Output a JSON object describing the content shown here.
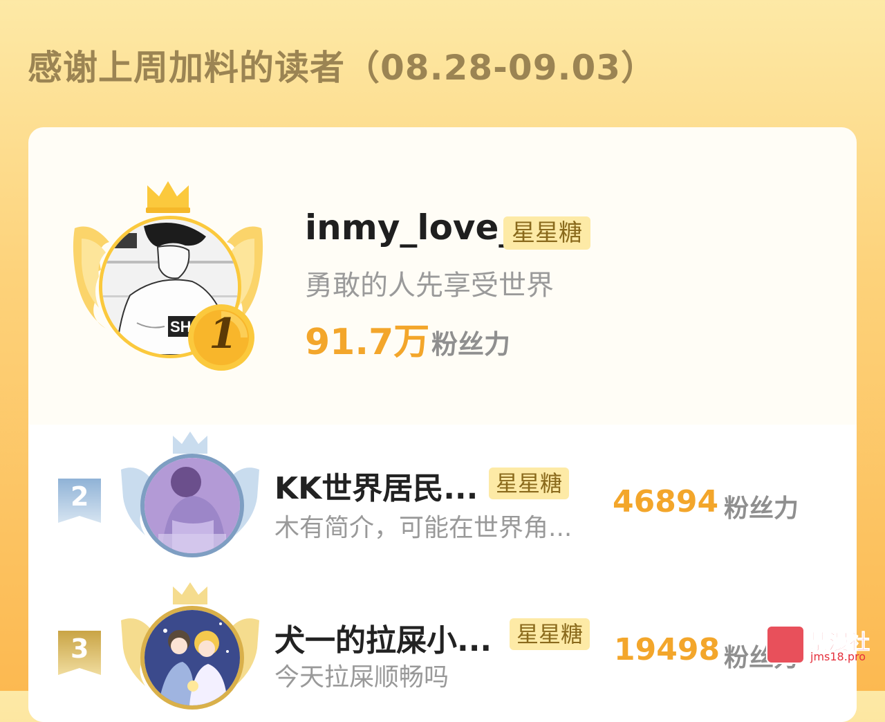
{
  "page": {
    "title": "感谢上周加料的读者（08.28-09.03）"
  },
  "colors": {
    "accent_orange": "#f3a62b",
    "gold": "#fbc93d",
    "silver": "#8fb2d6",
    "bronze": "#d9b04a",
    "tag_bg": "#fdeaa6"
  },
  "top_reader": {
    "rank": "1",
    "name": "inmy_love_",
    "tag": "星星糖",
    "bio": "勇敢的人先享受世界",
    "fans_value": "91.7万",
    "fans_label": "粉丝力",
    "avatar": "avatar-manga-boy",
    "badge_icon": "gold-crown-wings-icon"
  },
  "readers": [
    {
      "rank": "2",
      "name": "KK世界居民...",
      "tag": "星星糖",
      "bio": "木有简介，可能在世界角...",
      "fans_value": "46894",
      "fans_label": "粉丝力",
      "avatar": "avatar-purple-girl",
      "badge_icon": "silver-crown-wings-icon"
    },
    {
      "rank": "3",
      "name": "犬一的拉屎小...",
      "tag": "星星糖",
      "bio": "今天拉屎顺畅吗",
      "fans_value": "19498",
      "fans_label": "粉丝力",
      "avatar": "avatar-anime-couple",
      "badge_icon": "bronze-crown-wings-icon"
    }
  ],
  "watermark": {
    "title": "禁漫社",
    "url": "jms18.pro"
  }
}
